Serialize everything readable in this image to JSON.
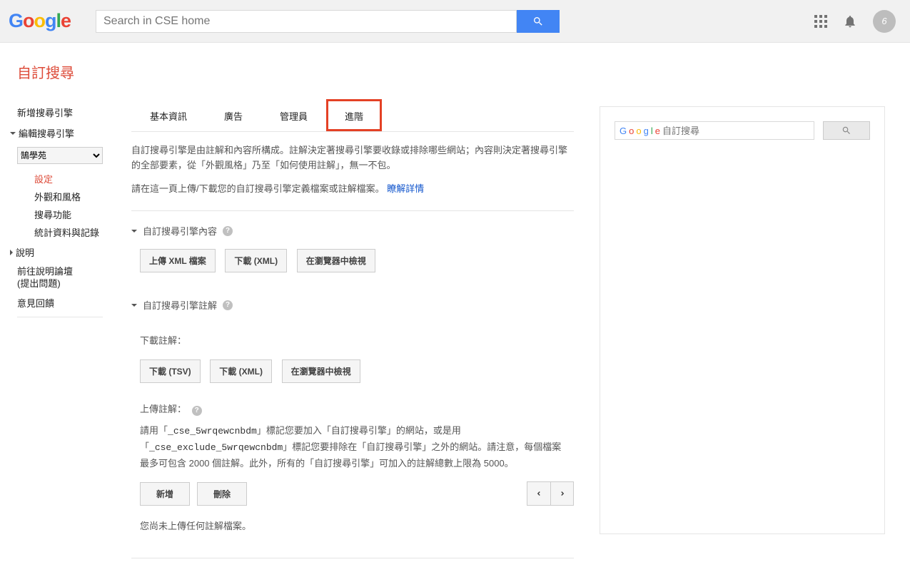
{
  "header": {
    "search_placeholder": "Search in CSE home",
    "avatar_initial": "6"
  },
  "page_title": "自訂搜尋",
  "sidebar": {
    "add_engine": "新增搜尋引擎",
    "edit_engine": "編輯搜尋引擎",
    "engine_select": "鵠學苑",
    "subs": {
      "settings": "設定",
      "look": "外觀和風格",
      "search": "搜尋功能",
      "stats": "統計資料與記錄"
    },
    "help": "說明",
    "forum_1": "前往說明論壇",
    "forum_2": "(提出問題)",
    "feedback": "意見回饋"
  },
  "tabs": {
    "basic": "基本資訊",
    "ads": "廣告",
    "admin": "管理員",
    "advanced": "進階"
  },
  "intro": {
    "p1": "自訂搜尋引擎是由註解和內容所構成。註解決定著搜尋引擎要收錄或排除哪些網站；內容則決定著搜尋引擎的全部要素，從「外觀風格」乃至「如何使用註解」，無一不包。",
    "p2a": "請在這一頁上傳/下載您的自訂搜尋引擎定義檔案或註解檔案。",
    "link": "瞭解詳情"
  },
  "sec_content": {
    "title": "自訂搜尋引擎內容",
    "btn_upload": "上傳 XML 檔案",
    "btn_download": "下載 (XML)",
    "btn_browser": "在瀏覽器中檢視"
  },
  "sec_anno": {
    "title": "自訂搜尋引擎註解",
    "download_label": "下載註解：",
    "btn_tsv": "下載 (TSV)",
    "btn_xml": "下載 (XML)",
    "btn_browser": "在瀏覽器中檢視",
    "upload_label": "上傳註解：",
    "help_a": "請用「",
    "code_include": "_cse_5wrqewcnbdm",
    "help_b": "」標記您要加入「自訂搜尋引擎」的網站，或是用「",
    "code_exclude": "_cse_exclude_5wrqewcnbdm",
    "help_c": "」標記您要排除在「自訂搜尋引擎」之外的網站。請注意，每個檔案最多可包含 2000 個註解。此外，所有的「自訂搜尋引擎」可加入的註解總數上限為 5000。",
    "btn_add": "新增",
    "btn_delete": "刪除",
    "empty_msg": "您尚未上傳任何註解檔案。"
  },
  "embed": {
    "placeholder": "自訂搜尋"
  }
}
